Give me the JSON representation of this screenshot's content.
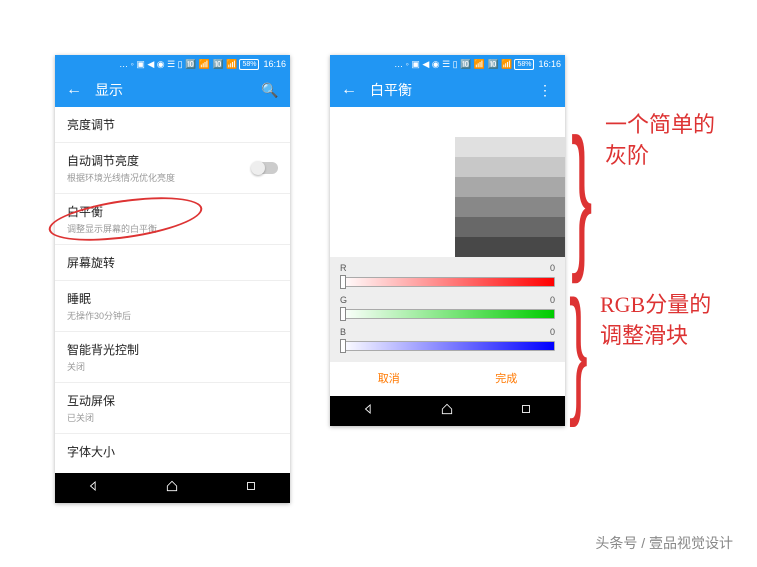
{
  "status": {
    "battery": "58%",
    "time": "16:16"
  },
  "left": {
    "title": "显示",
    "items": [
      {
        "primary": "亮度调节",
        "secondary": ""
      },
      {
        "primary": "自动调节亮度",
        "secondary": "根据环境光线情况优化亮度",
        "switch": true
      },
      {
        "primary": "白平衡",
        "secondary": "调整显示屏幕的白平衡"
      },
      {
        "primary": "屏幕旋转",
        "secondary": ""
      },
      {
        "primary": "睡眠",
        "secondary": "无操作30分钟后"
      },
      {
        "primary": "智能背光控制",
        "secondary": "关闭"
      },
      {
        "primary": "互动屏保",
        "secondary": "已关闭"
      },
      {
        "primary": "字体大小",
        "secondary": ""
      }
    ]
  },
  "right": {
    "title": "白平衡",
    "sliders": {
      "r": {
        "label": "R",
        "value": "0"
      },
      "g": {
        "label": "G",
        "value": "0"
      },
      "b": {
        "label": "B",
        "value": "0"
      }
    },
    "cancel": "取消",
    "done": "完成"
  },
  "annotations": {
    "note1": "一个简单的灰阶",
    "note2": "RGB分量的调整滑块"
  },
  "watermark": "头条号 / 壹品视觉设计"
}
